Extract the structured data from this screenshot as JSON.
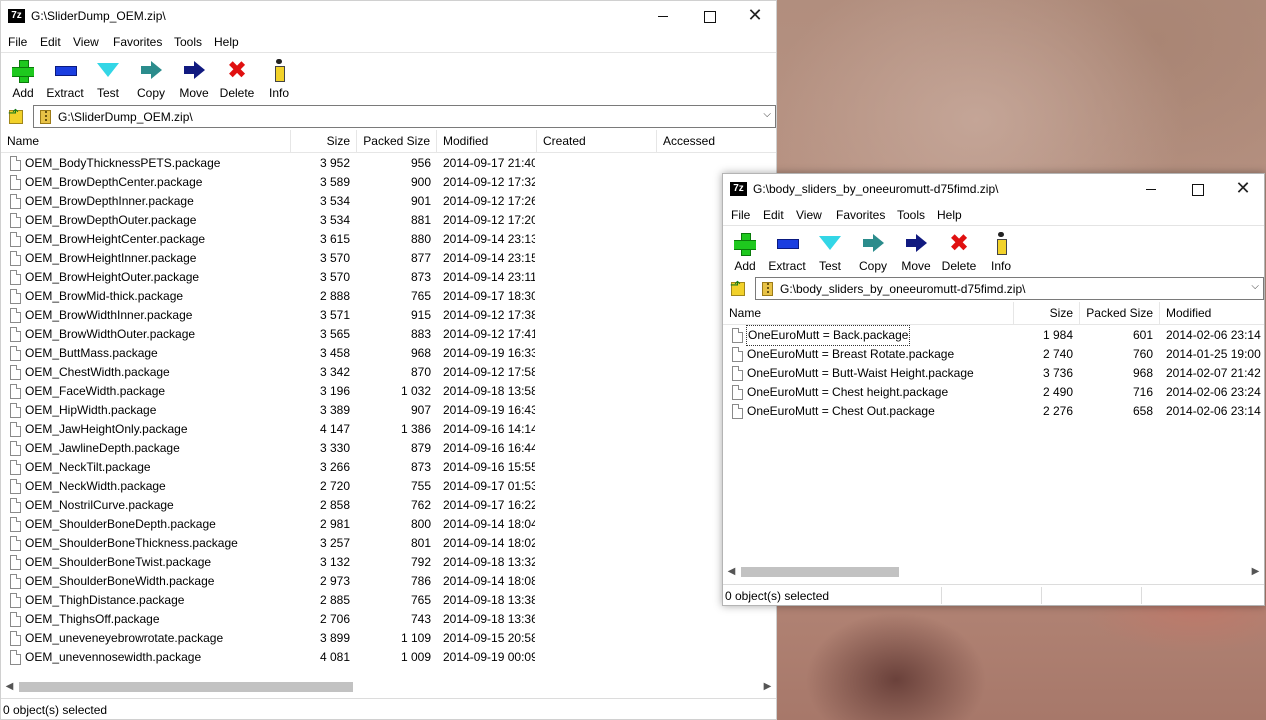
{
  "window1": {
    "title": "G:\\SliderDump_OEM.zip\\",
    "icon_label": "7z",
    "menu": [
      "File",
      "Edit",
      "View",
      "Favorites",
      "Tools",
      "Help"
    ],
    "toolbar": [
      {
        "label": "Add",
        "icon": "add-icon"
      },
      {
        "label": "Extract",
        "icon": "extract-icon"
      },
      {
        "label": "Test",
        "icon": "test-icon"
      },
      {
        "label": "Copy",
        "icon": "copy-icon"
      },
      {
        "label": "Move",
        "icon": "move-icon"
      },
      {
        "label": "Delete",
        "icon": "delete-icon"
      },
      {
        "label": "Info",
        "icon": "info-icon"
      }
    ],
    "address": "G:\\SliderDump_OEM.zip\\",
    "columns": [
      "Name",
      "Size",
      "Packed Size",
      "Modified",
      "Created",
      "Accessed"
    ],
    "rows": [
      {
        "name": "OEM_BodyThicknessPETS.package",
        "size": "3 952",
        "packed": "956",
        "modified": "2014-09-17 21:40"
      },
      {
        "name": "OEM_BrowDepthCenter.package",
        "size": "3 589",
        "packed": "900",
        "modified": "2014-09-12 17:32"
      },
      {
        "name": "OEM_BrowDepthInner.package",
        "size": "3 534",
        "packed": "901",
        "modified": "2014-09-12 17:26"
      },
      {
        "name": "OEM_BrowDepthOuter.package",
        "size": "3 534",
        "packed": "881",
        "modified": "2014-09-12 17:20"
      },
      {
        "name": "OEM_BrowHeightCenter.package",
        "size": "3 615",
        "packed": "880",
        "modified": "2014-09-14 23:13"
      },
      {
        "name": "OEM_BrowHeightInner.package",
        "size": "3 570",
        "packed": "877",
        "modified": "2014-09-14 23:15"
      },
      {
        "name": "OEM_BrowHeightOuter.package",
        "size": "3 570",
        "packed": "873",
        "modified": "2014-09-14 23:11"
      },
      {
        "name": "OEM_BrowMid-thick.package",
        "size": "2 888",
        "packed": "765",
        "modified": "2014-09-17 18:30"
      },
      {
        "name": "OEM_BrowWidthInner.package",
        "size": "3 571",
        "packed": "915",
        "modified": "2014-09-12 17:38"
      },
      {
        "name": "OEM_BrowWidthOuter.package",
        "size": "3 565",
        "packed": "883",
        "modified": "2014-09-12 17:41"
      },
      {
        "name": "OEM_ButtMass.package",
        "size": "3 458",
        "packed": "968",
        "modified": "2014-09-19 16:33"
      },
      {
        "name": "OEM_ChestWidth.package",
        "size": "3 342",
        "packed": "870",
        "modified": "2014-09-12 17:58"
      },
      {
        "name": "OEM_FaceWidth.package",
        "size": "3 196",
        "packed": "1 032",
        "modified": "2014-09-18 13:58"
      },
      {
        "name": "OEM_HipWidth.package",
        "size": "3 389",
        "packed": "907",
        "modified": "2014-09-19 16:43"
      },
      {
        "name": "OEM_JawHeightOnly.package",
        "size": "4 147",
        "packed": "1 386",
        "modified": "2014-09-16 14:14"
      },
      {
        "name": "OEM_JawlineDepth.package",
        "size": "3 330",
        "packed": "879",
        "modified": "2014-09-16 16:44"
      },
      {
        "name": "OEM_NeckTilt.package",
        "size": "3 266",
        "packed": "873",
        "modified": "2014-09-16 15:55"
      },
      {
        "name": "OEM_NeckWidth.package",
        "size": "2 720",
        "packed": "755",
        "modified": "2014-09-17 01:53"
      },
      {
        "name": "OEM_NostrilCurve.package",
        "size": "2 858",
        "packed": "762",
        "modified": "2014-09-17 16:22"
      },
      {
        "name": "OEM_ShoulderBoneDepth.package",
        "size": "2 981",
        "packed": "800",
        "modified": "2014-09-14 18:04"
      },
      {
        "name": "OEM_ShoulderBoneThickness.package",
        "size": "3 257",
        "packed": "801",
        "modified": "2014-09-14 18:02"
      },
      {
        "name": "OEM_ShoulderBoneTwist.package",
        "size": "3 132",
        "packed": "792",
        "modified": "2014-09-18 13:32"
      },
      {
        "name": "OEM_ShoulderBoneWidth.package",
        "size": "2 973",
        "packed": "786",
        "modified": "2014-09-14 18:08"
      },
      {
        "name": "OEM_ThighDistance.package",
        "size": "2 885",
        "packed": "765",
        "modified": "2014-09-18 13:38"
      },
      {
        "name": "OEM_ThighsOff.package",
        "size": "2 706",
        "packed": "743",
        "modified": "2014-09-18 13:36"
      },
      {
        "name": "OEM_uneveneyebrowrotate.package",
        "size": "3 899",
        "packed": "1 109",
        "modified": "2014-09-15 20:58"
      },
      {
        "name": "OEM_unevennosewidth.package",
        "size": "4 081",
        "packed": "1 009",
        "modified": "2014-09-19 00:09"
      }
    ],
    "status": "0 object(s) selected"
  },
  "window2": {
    "title": "G:\\body_sliders_by_oneeuromutt-d75fimd.zip\\",
    "icon_label": "7z",
    "menu": [
      "File",
      "Edit",
      "View",
      "Favorites",
      "Tools",
      "Help"
    ],
    "toolbar": [
      {
        "label": "Add",
        "icon": "add-icon"
      },
      {
        "label": "Extract",
        "icon": "extract-icon"
      },
      {
        "label": "Test",
        "icon": "test-icon"
      },
      {
        "label": "Copy",
        "icon": "copy-icon"
      },
      {
        "label": "Move",
        "icon": "move-icon"
      },
      {
        "label": "Delete",
        "icon": "delete-icon"
      },
      {
        "label": "Info",
        "icon": "info-icon"
      }
    ],
    "address": "G:\\body_sliders_by_oneeuromutt-d75fimd.zip\\",
    "columns": [
      "Name",
      "Size",
      "Packed Size",
      "Modified"
    ],
    "rows": [
      {
        "name": "OneEuroMutt = Back.package",
        "size": "1 984",
        "packed": "601",
        "modified": "2014-02-06 23:14"
      },
      {
        "name": "OneEuroMutt = Breast Rotate.package",
        "size": "2 740",
        "packed": "760",
        "modified": "2014-01-25 19:00"
      },
      {
        "name": "OneEuroMutt = Butt-Waist Height.package",
        "size": "3 736",
        "packed": "968",
        "modified": "2014-02-07 21:42"
      },
      {
        "name": "OneEuroMutt = Chest height.package",
        "size": "2 490",
        "packed": "716",
        "modified": "2014-02-06 23:24"
      },
      {
        "name": "OneEuroMutt = Chest Out.package",
        "size": "2 276",
        "packed": "658",
        "modified": "2014-02-06 23:14"
      }
    ],
    "status": "0 object(s) selected"
  }
}
